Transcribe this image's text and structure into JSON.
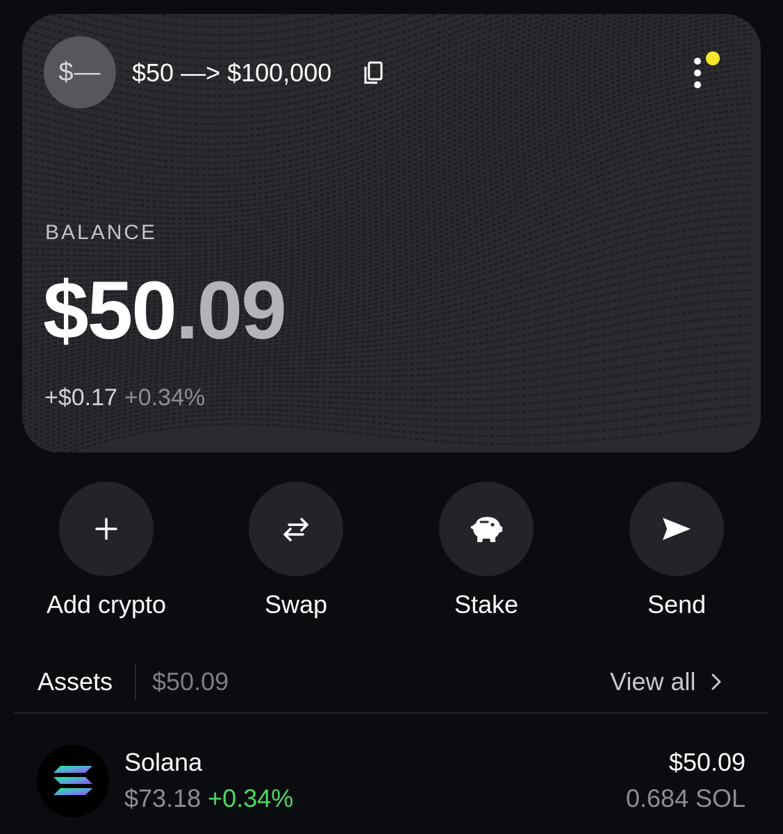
{
  "colors": {
    "background": "#0b0c0f",
    "card": "#2a2b2f",
    "action_button": "#232428",
    "positive": "#4cd964",
    "notification_dot": "#f5e52c",
    "muted_text": "#8d8e93"
  },
  "wallet": {
    "avatar_text": "$—",
    "name": "$50 —> $100,000",
    "copy_icon": "copy-icon",
    "menu_icon": "kebab-menu-icon",
    "has_notification": true
  },
  "balance": {
    "label": "BALANCE",
    "whole": "$50",
    "fraction": ".09",
    "change_amount": "+$0.17",
    "change_percent": "+0.34%"
  },
  "actions": [
    {
      "label": "Add crypto",
      "icon": "plus-icon"
    },
    {
      "label": "Swap",
      "icon": "swap-arrows-icon"
    },
    {
      "label": "Stake",
      "icon": "piggy-bank-icon"
    },
    {
      "label": "Send",
      "icon": "send-icon"
    }
  ],
  "assets": {
    "title": "Assets",
    "total": "$50.09",
    "view_all_label": "View all",
    "items": [
      {
        "name": "Solana",
        "price": "$73.18",
        "change": "+0.34%",
        "value": "$50.09",
        "quantity": "0.684 SOL",
        "icon": "solana-logo-icon"
      }
    ]
  }
}
